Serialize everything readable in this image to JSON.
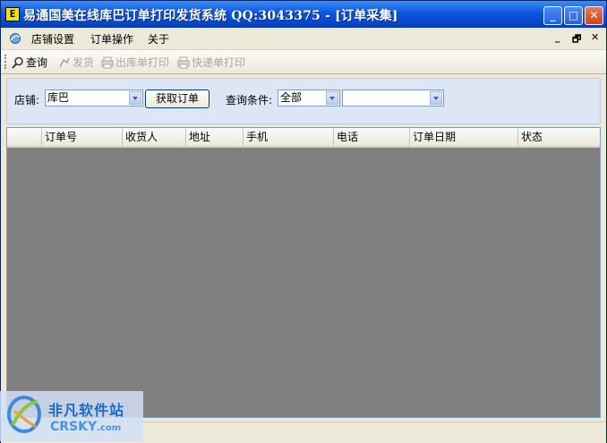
{
  "window": {
    "app_icon_text": "E",
    "title": "易通国美在线库巴订单打印发货系统 QQ:3043375 - [订单采集]",
    "minimize": "_",
    "maximize": "□",
    "close": "✕"
  },
  "menu": {
    "items": [
      "店铺设置",
      "订单操作",
      "关于"
    ],
    "mdi_minimize": "_",
    "mdi_restore": "🗗",
    "mdi_close": "✕"
  },
  "toolbar": {
    "query": "查询",
    "ship": "发货",
    "print_outbound": "出库单打印",
    "print_express": "快递单打印"
  },
  "search": {
    "store_label": "店铺:",
    "store_value": "库巴",
    "fetch_button": "获取订单",
    "condition_label": "查询条件:",
    "condition_value": "全部",
    "condition_value2": ""
  },
  "grid": {
    "columns": [
      "订单号",
      "收货人",
      "地址",
      "手机",
      "电话",
      "订单日期",
      "状态"
    ]
  },
  "watermark": {
    "cn": "非凡软件站",
    "en": "CRSKY",
    "en_suffix": ".com"
  }
}
